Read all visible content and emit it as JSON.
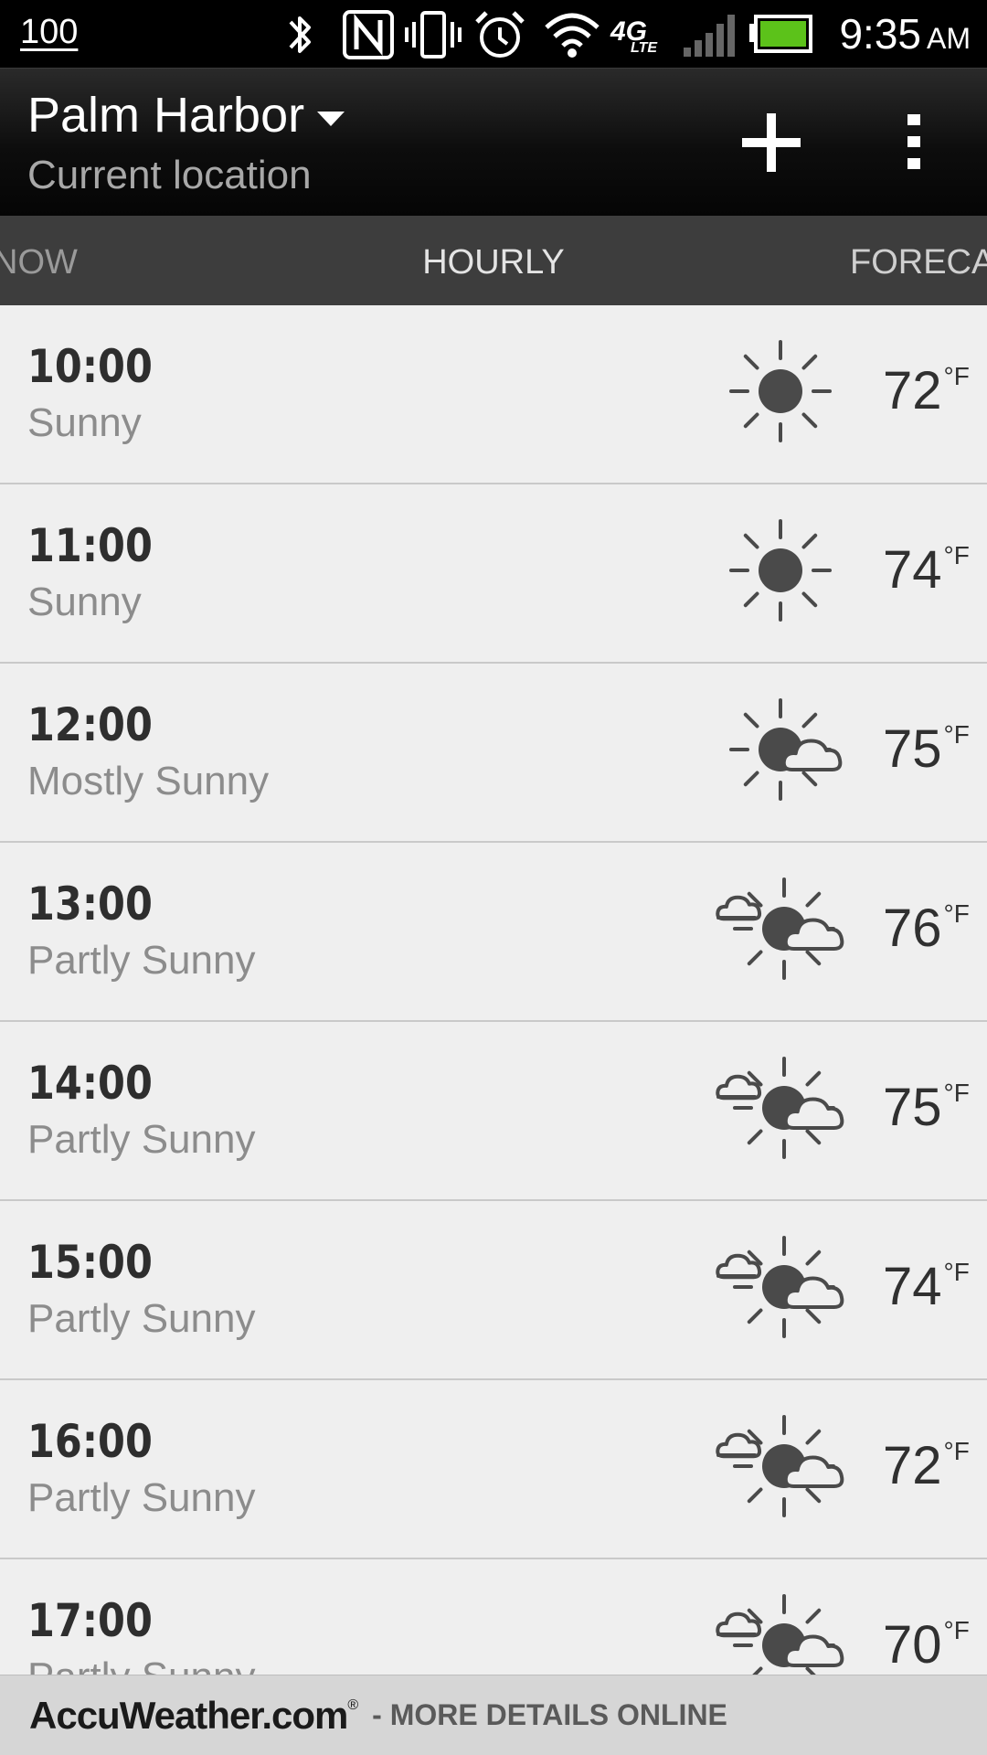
{
  "status_bar": {
    "battery_level": "100",
    "network": "4G",
    "network_sub": "LTE",
    "time": "9:35",
    "ampm": "AM",
    "icons": [
      "bluetooth-icon",
      "nfc-icon",
      "vibrate-icon",
      "alarm-icon",
      "wifi-icon",
      "lte-icon",
      "signal-icon",
      "battery-icon"
    ],
    "battery_color": "#5cc21a"
  },
  "header": {
    "location": "Palm Harbor",
    "subtitle": "Current location",
    "add_icon": "plus-icon",
    "menu_icon": "overflow-menu-icon"
  },
  "tabs": [
    {
      "label": "NOW"
    },
    {
      "label": "HOURLY",
      "selected": true
    },
    {
      "label": "FORECAST"
    }
  ],
  "hourly": [
    {
      "time": "10:00",
      "condition": "Sunny",
      "temp": "72",
      "unit": "°F",
      "icon": "sunny"
    },
    {
      "time": "11:00",
      "condition": "Sunny",
      "temp": "74",
      "unit": "°F",
      "icon": "sunny"
    },
    {
      "time": "12:00",
      "condition": "Mostly Sunny",
      "temp": "75",
      "unit": "°F",
      "icon": "mostly-sunny"
    },
    {
      "time": "13:00",
      "condition": "Partly Sunny",
      "temp": "76",
      "unit": "°F",
      "icon": "partly-sunny"
    },
    {
      "time": "14:00",
      "condition": "Partly Sunny",
      "temp": "75",
      "unit": "°F",
      "icon": "partly-sunny"
    },
    {
      "time": "15:00",
      "condition": "Partly Sunny",
      "temp": "74",
      "unit": "°F",
      "icon": "partly-sunny"
    },
    {
      "time": "16:00",
      "condition": "Partly Sunny",
      "temp": "72",
      "unit": "°F",
      "icon": "partly-sunny"
    },
    {
      "time": "17:00",
      "condition": "Partly Sunny",
      "temp": "70",
      "unit": "°F",
      "icon": "partly-sunny"
    }
  ],
  "footer": {
    "brand": "AccuWeather.com",
    "registered": "®",
    "link": "- MORE DETAILS ONLINE"
  }
}
